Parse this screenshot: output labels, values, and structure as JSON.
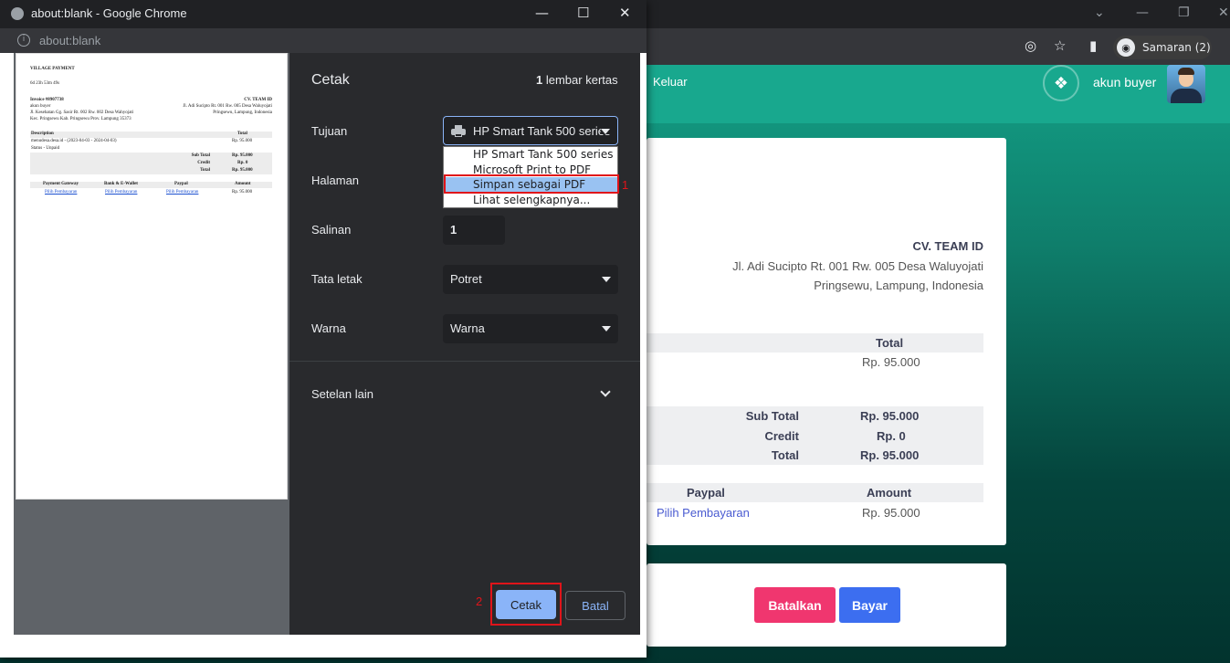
{
  "browser_bg": {
    "profile_label": "Samaran (2)"
  },
  "page": {
    "nav": {
      "logout": "Keluar",
      "user": "akun buyer"
    },
    "company": {
      "name": "CV. TEAM ID",
      "address1": "Jl. Adi Sucipto Rt. 001 Rw. 005 Desa Waluyojati",
      "address2": "Pringsewu, Lampung, Indonesia"
    },
    "table": {
      "total_header": "Total",
      "row_total": "Rp. 95.000",
      "subtotal_label": "Sub Total",
      "subtotal_value": "Rp. 95.000",
      "credit_label": "Credit",
      "credit_value": "Rp. 0",
      "total_label": "Total",
      "total_value": "Rp. 95.000"
    },
    "payment": {
      "paypal_header": "Paypal",
      "amount_header": "Amount",
      "paypal_link": "Pilih Pembayaran",
      "amount_value": "Rp. 95.000"
    },
    "buttons": {
      "cancel": "Batalkan",
      "pay": "Bayar"
    }
  },
  "popup": {
    "window_title": "about:blank - Google Chrome",
    "url": "about:blank"
  },
  "preview": {
    "heading": "VILLAGE PAYMENT",
    "date": "6d 23h 53m 49s",
    "invoice": "Invoice #8907738",
    "company": "CV. TEAM ID",
    "buyer": "akun buyer",
    "buyer_addr1": "Jl. Kesehatan Gg. Sasir Rt. 002 Rw. 002 Desa Wahyojati",
    "buyer_addr2": "Kec. Pringsewu Kab. Pringsewu Prov. Lampung 35373",
    "company_addr1": "Jl. Adi Sucipto Rt. 001 Rw. 005 Desa Waluyojati",
    "company_addr2": "Pringsewu, Lampung, Indonesia",
    "desc_header": "Description",
    "total_header": "Total",
    "item": "menudesa.desa.id - (2023-04-03 - 2024-04-03)",
    "item_value": "Rp. 95.000",
    "status": "Status - Unpaid",
    "subtotal_label": "Sub Total",
    "subtotal_value": "Rp. 95.000",
    "credit_label": "Credit",
    "credit_value": "Rp. 0",
    "total_label": "Total",
    "total_value": "Rp. 95.000",
    "pay_headers": [
      "Payment Gateway",
      "Bank & E-Wallet",
      "Paypal",
      "Amount"
    ],
    "pay_links": [
      "Pilih Pembayaran",
      "Pilih Pembayaran",
      "Pilih Pembayaran"
    ],
    "pay_amount": "Rp. 95.000"
  },
  "print": {
    "title": "Cetak",
    "sheets_count": "1",
    "sheets_label": "lembar kertas",
    "destination_label": "Tujuan",
    "destination_value": "HP Smart Tank 500 series",
    "destination_options": [
      "HP Smart Tank 500 series",
      "Microsoft Print to PDF",
      "Simpan sebagai PDF",
      "Lihat selengkapnya..."
    ],
    "pages_label": "Halaman",
    "copies_label": "Salinan",
    "copies_value": "1",
    "layout_label": "Tata letak",
    "layout_value": "Potret",
    "color_label": "Warna",
    "color_value": "Warna",
    "more_settings": "Setelan lain",
    "print_button": "Cetak",
    "cancel_button": "Batal"
  },
  "annotations": {
    "step1": "1",
    "step2": "2"
  },
  "colors": {
    "teal": "#18a88e",
    "dialog_bg": "#292a2d",
    "accent": "#8ab4f8",
    "annotation_red": "#e0141a",
    "pay_blue": "#3c6ef0",
    "cancel_pink": "#f0366f"
  }
}
